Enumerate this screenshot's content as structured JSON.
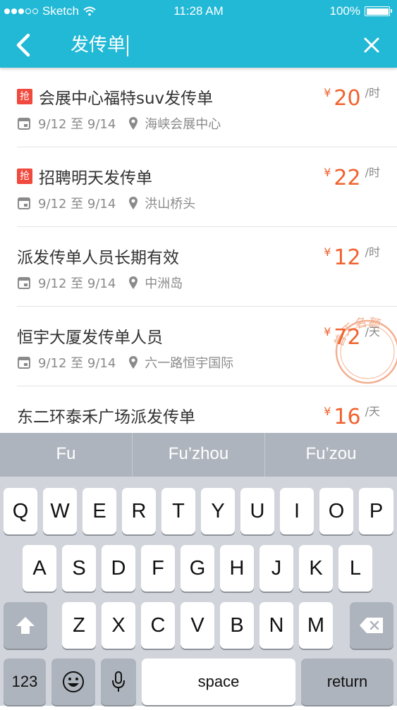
{
  "status_bar": {
    "carrier": "Sketch",
    "time": "11:28 AM",
    "battery": "100%"
  },
  "search": {
    "query": "发传单"
  },
  "jobs": [
    {
      "title": "会展中心福特suv发传单",
      "badge": "抢",
      "date": "9/12 至 9/14",
      "location": "海峡会展中心",
      "price": "20",
      "unit": "/时"
    },
    {
      "title": "招聘明天发传单",
      "badge": "抢",
      "date": "9/12 至 9/14",
      "location": "洪山桥头",
      "price": "22",
      "unit": "/时"
    },
    {
      "title": "派发传单人员长期有效",
      "badge": "",
      "date": "9/12 至 9/14",
      "location": "中洲岛",
      "price": "12",
      "unit": "/时"
    },
    {
      "title": "恒宇大厦发传单人员",
      "badge": "",
      "date": "9/12 至 9/14",
      "location": "六一路恒宇国际",
      "price": "72",
      "unit": "/天",
      "stamp": "普天名额"
    },
    {
      "title": "东二环泰禾广场派发传单",
      "badge": "",
      "date": "",
      "location": "",
      "price": "16",
      "unit": "/天"
    }
  ],
  "currency_symbol": "¥",
  "keyboard": {
    "suggestions": [
      "Fu",
      "Fu’zhou",
      "Fu’zou"
    ],
    "row1": [
      "Q",
      "W",
      "E",
      "R",
      "T",
      "Y",
      "U",
      "I",
      "O",
      "P"
    ],
    "row2": [
      "A",
      "S",
      "D",
      "F",
      "G",
      "H",
      "J",
      "K",
      "L"
    ],
    "row3": [
      "Z",
      "X",
      "C",
      "V",
      "B",
      "N",
      "M"
    ],
    "numbers_key": "123",
    "space_key": "space",
    "return_key": "return"
  },
  "colors": {
    "accent": "#22b9d6",
    "price": "#f0622e",
    "badge": "#f0493e"
  }
}
